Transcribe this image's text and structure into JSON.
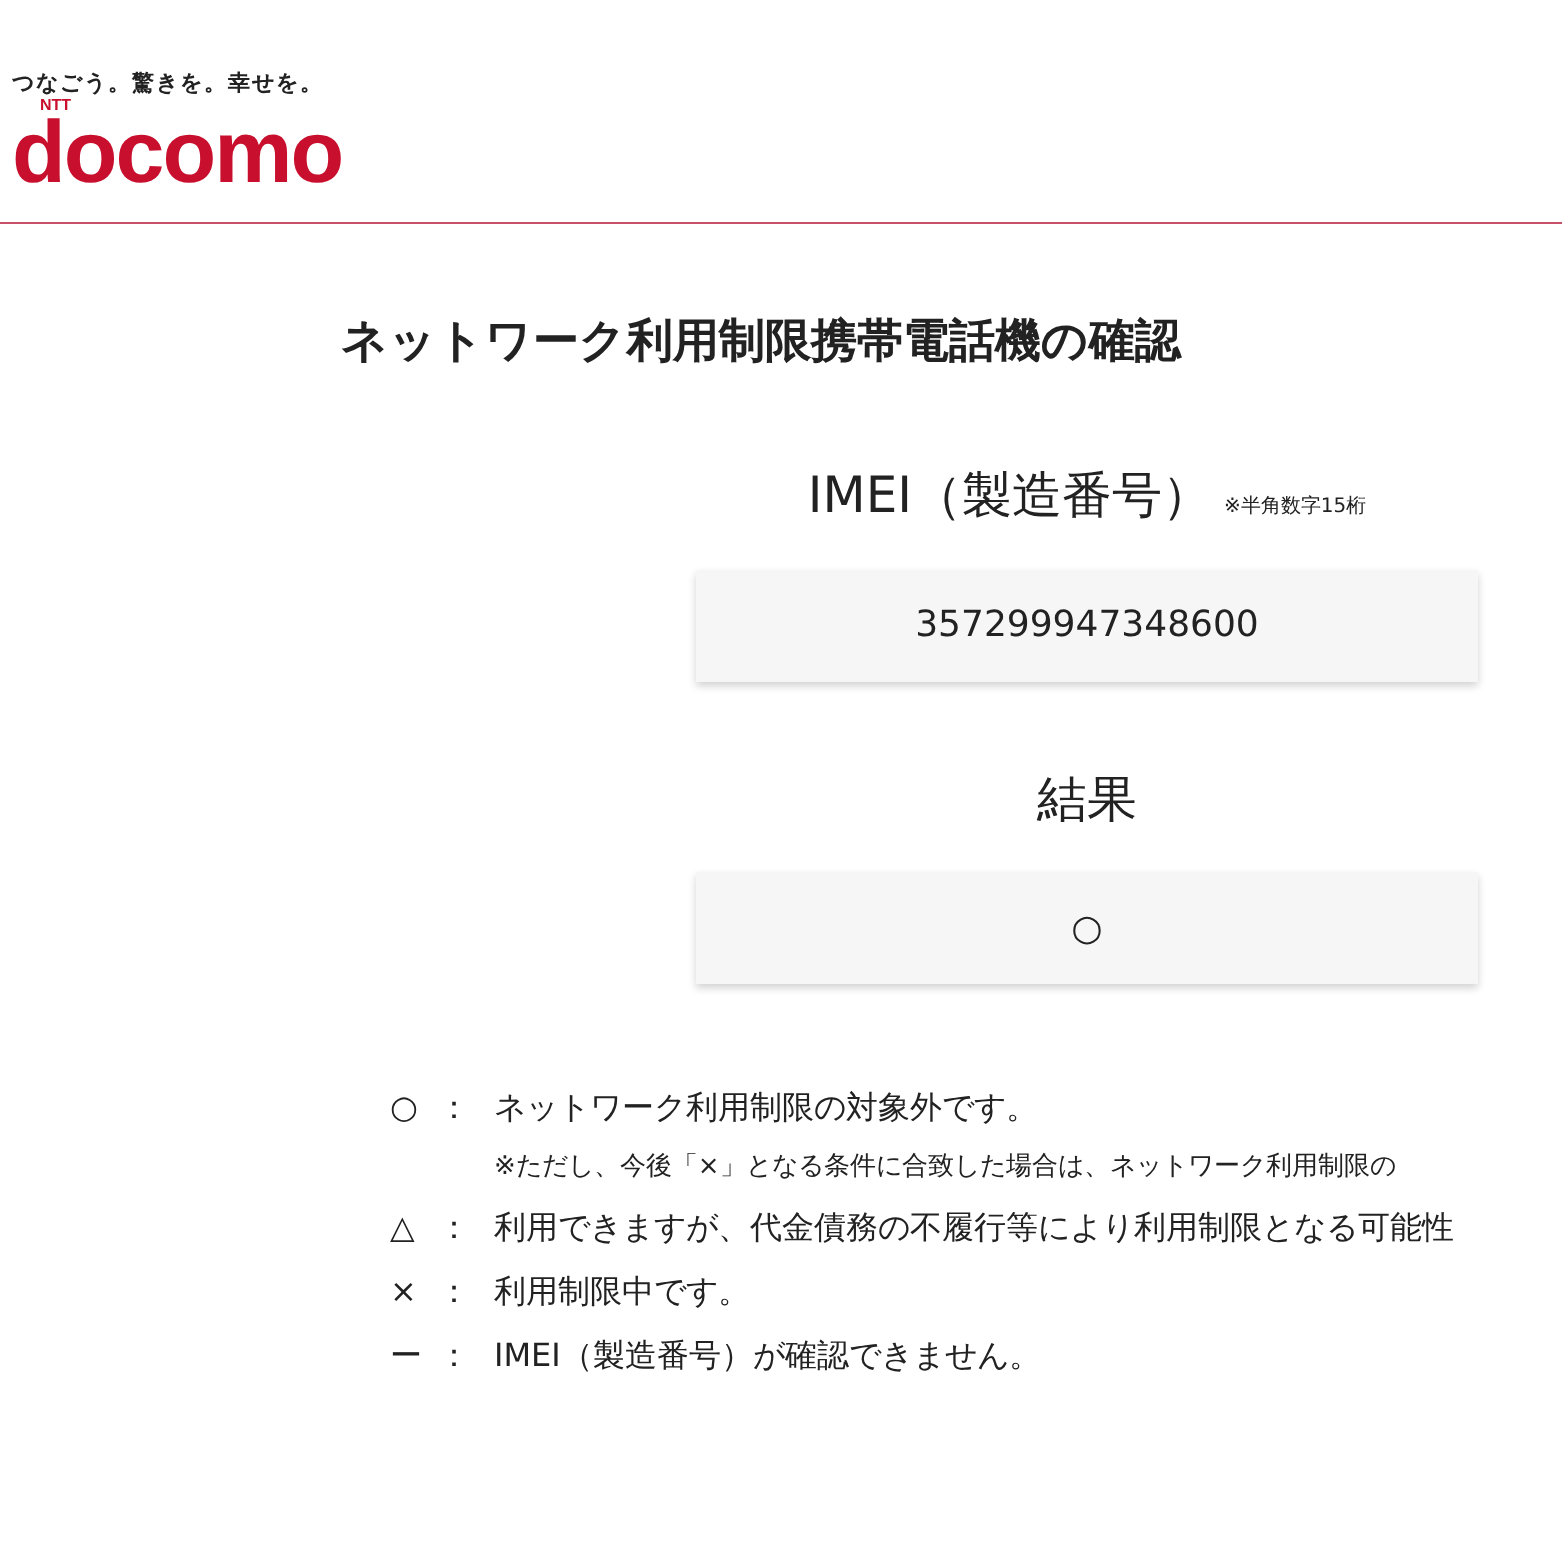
{
  "header": {
    "tagline": "つなごう。驚きを。幸せを。",
    "logo_small": "NTT",
    "logo": "docomo"
  },
  "title": "ネットワーク利用制限携帯電話機の確認",
  "imei": {
    "label": "IMEI（製造番号）",
    "note": "※半角数字15桁",
    "value": "357299947348600"
  },
  "result": {
    "label": "結果",
    "value": "○"
  },
  "legend": [
    {
      "kind": "entry",
      "symbol": "○",
      "sep": "：",
      "text": "ネットワーク利用制限の対象外です。"
    },
    {
      "kind": "note",
      "text": "※ただし、今後「×」となる条件に合致した場合は、ネットワーク利用制限の"
    },
    {
      "kind": "entry",
      "symbol": "△",
      "sep": "：",
      "text": "利用できますが、代金債務の不履行等により利用制限となる可能性"
    },
    {
      "kind": "entry",
      "symbol": "×",
      "sep": "：",
      "text": "利用制限中です。"
    },
    {
      "kind": "entry",
      "symbol": "ー",
      "sep": "：",
      "text": "IMEI（製造番号）が確認できません。"
    }
  ]
}
